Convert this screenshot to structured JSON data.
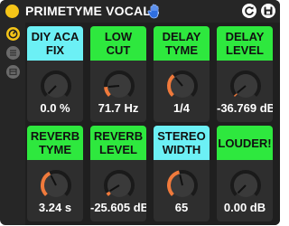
{
  "device": {
    "title": "PRIMETYME VOCALS",
    "icons": {
      "power": "power-icon",
      "hand": "hand-icon",
      "refresh": "refresh-icon",
      "save": "save-icon"
    }
  },
  "sidebar": {
    "buttons": [
      {
        "icon": "automation-icon",
        "color": "#f5c518"
      },
      {
        "icon": "list-icon",
        "color": "#6a6a6a"
      },
      {
        "icon": "preset-icon",
        "color": "#6a6a6a"
      }
    ]
  },
  "colors": {
    "green": "#2ee83e",
    "cyan": "#6cf0f5",
    "knob_arc": "#f07a3c",
    "knob_body": "#3a3a3a",
    "accent": "#f5c518"
  },
  "params": [
    {
      "line1": "DIY ACA",
      "line2": "FIX",
      "value": "0.0 %",
      "level": 0.0,
      "color": "cyan"
    },
    {
      "line1": "LOW",
      "line2": "CUT",
      "value": "71.7 Hz",
      "level": 0.15,
      "color": "green"
    },
    {
      "line1": "DELAY",
      "line2": "TYME",
      "value": "1/4",
      "level": 0.35,
      "color": "green"
    },
    {
      "line1": "DELAY",
      "line2": "LEVEL",
      "value": "-36.769 dB",
      "level": 0.02,
      "color": "green"
    },
    {
      "line1": "REVERB",
      "line2": "TYME",
      "value": "3.24 s",
      "level": 0.4,
      "color": "green"
    },
    {
      "line1": "REVERB",
      "line2": "LEVEL",
      "value": "-25.605 dB",
      "level": 0.05,
      "color": "green"
    },
    {
      "line1": "STEREO",
      "line2": "WIDTH",
      "value": "65",
      "level": 0.45,
      "color": "cyan"
    },
    {
      "line1": "LOUDER!",
      "line2": "",
      "value": "0.00 dB",
      "level": 0.0,
      "color": "green"
    }
  ]
}
